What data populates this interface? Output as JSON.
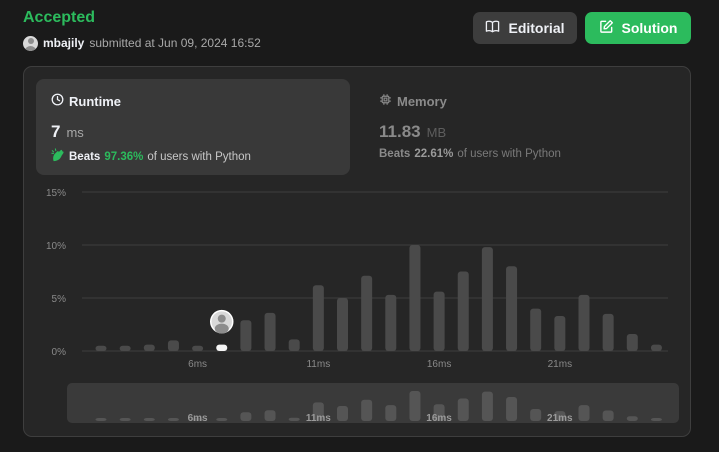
{
  "header": {
    "status": "Accepted",
    "username": "mbajily",
    "submitted_text": "submitted at Jun 09, 2024 16:52"
  },
  "buttons": {
    "editorial_label": "Editorial",
    "solution_label": "Solution"
  },
  "runtime": {
    "title": "Runtime",
    "value": "7",
    "unit": "ms",
    "beats_prefix": "Beats",
    "beats_pct": "97.36%",
    "beats_suffix": "of users with Python"
  },
  "memory": {
    "title": "Memory",
    "value": "11.83",
    "unit": "MB",
    "beats_prefix": "Beats",
    "beats_pct": "22.61%",
    "beats_suffix": "of users with Python"
  },
  "colors": {
    "accent_green": "#2cbb5d",
    "bar": "#4a4a4a",
    "highlight_bar": "#f5f5f5"
  },
  "chart_data": {
    "type": "bar",
    "y_ticks": [
      "15%",
      "10%",
      "5%",
      "0%"
    ],
    "ylim": [
      0,
      15
    ],
    "x_ticks": [
      "6ms",
      "11ms",
      "16ms",
      "21ms"
    ],
    "x": [
      2,
      3,
      4,
      5,
      6,
      7,
      8,
      9,
      10,
      11,
      12,
      13,
      14,
      15,
      16,
      17,
      18,
      19,
      20,
      21,
      22,
      23,
      24,
      25
    ],
    "values": [
      0.5,
      0.5,
      0.6,
      1.0,
      0.5,
      0.6,
      2.9,
      3.6,
      1.1,
      6.2,
      5.0,
      7.1,
      5.3,
      10.0,
      5.6,
      7.5,
      9.8,
      8.0,
      4.0,
      3.3,
      5.3,
      3.5,
      1.6,
      0.6
    ],
    "highlight_x": 7,
    "grid": true,
    "overview": {
      "x_ticks": [
        "6ms",
        "11ms",
        "16ms",
        "21ms"
      ]
    }
  }
}
